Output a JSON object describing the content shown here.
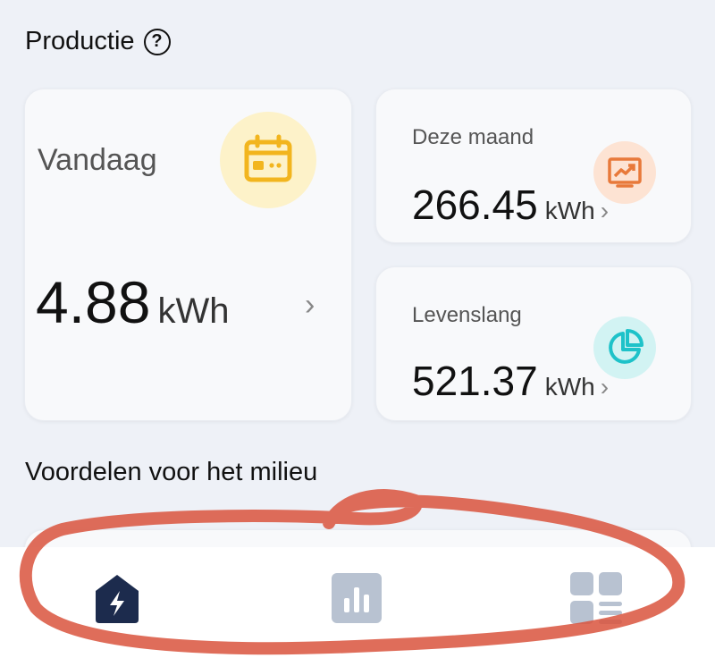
{
  "production": {
    "title": "Productie",
    "help_icon": "question-circle-icon",
    "today": {
      "label": "Vandaag",
      "value": "4.88",
      "unit": "kWh",
      "chevron": "›",
      "icon": "calendar-icon"
    },
    "month": {
      "label": "Deze maand",
      "value": "266.45",
      "unit": "kWh",
      "chevron": "›",
      "icon": "trend-chart-icon"
    },
    "lifetime": {
      "label": "Levenslang",
      "value": "521.37",
      "unit": "kWh",
      "chevron": "›",
      "icon": "pie-chart-icon"
    }
  },
  "environment": {
    "title": "Voordelen voor het milieu"
  },
  "nav": {
    "items": [
      {
        "name": "home",
        "icon": "home-bolt-icon",
        "active": true
      },
      {
        "name": "statistics",
        "icon": "bar-chart-icon",
        "active": false
      },
      {
        "name": "menu",
        "icon": "grid-menu-icon",
        "active": false
      }
    ]
  },
  "colors": {
    "active_nav": "#1c2b4d",
    "inactive_nav": "#b8c2d1",
    "annotation": "#d9533d",
    "calendar_accent": "#f2b51e",
    "trend_accent": "#e8793a",
    "pie_accent": "#1ec2c9"
  }
}
